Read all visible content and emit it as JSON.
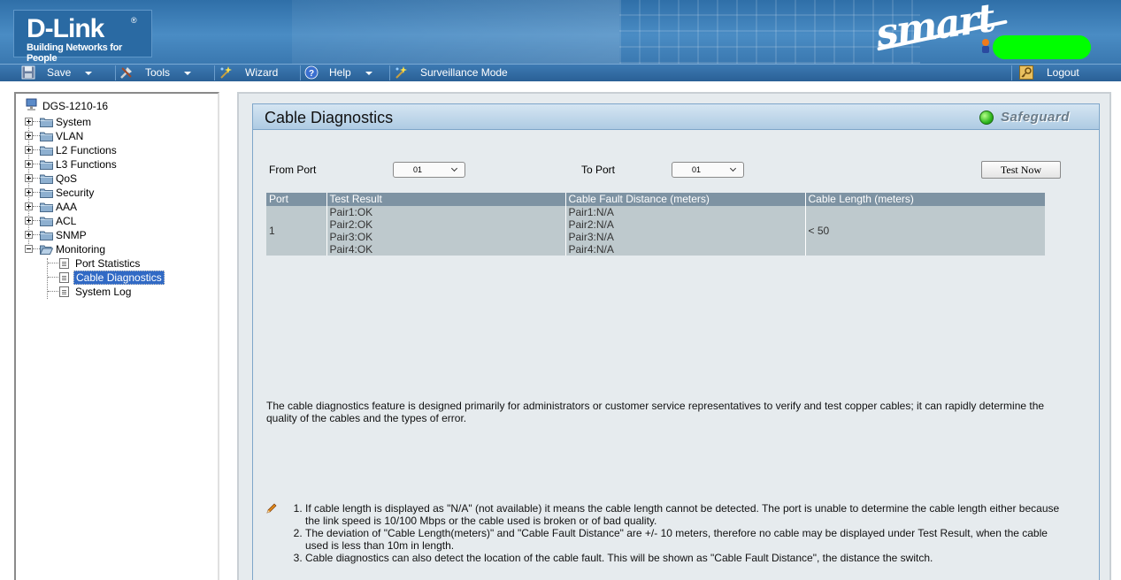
{
  "header": {
    "brand": "D-Link",
    "brand_mark": "®",
    "tagline": "Building Networks for People",
    "product_logo": "smart"
  },
  "menubar": {
    "save": "Save",
    "tools": "Tools",
    "wizard": "Wizard",
    "help": "Help",
    "surveillance": "Surveillance Mode",
    "logout": "Logout"
  },
  "tree": {
    "root": "DGS-1210-16",
    "nodes": [
      "System",
      "VLAN",
      "L2 Functions",
      "L3 Functions",
      "QoS",
      "Security",
      "AAA",
      "ACL",
      "SNMP",
      "Monitoring"
    ],
    "leaves": [
      "Port Statistics",
      "Cable Diagnostics",
      "System Log"
    ],
    "selected": "Cable Diagnostics"
  },
  "page": {
    "title": "Cable Diagnostics",
    "safeguard": "Safeguard",
    "from_port_label": "From Port",
    "from_port_value": "01",
    "to_port_label": "To Port",
    "to_port_value": "01",
    "test_button": "Test Now"
  },
  "table": {
    "headers": [
      "Port",
      "Test Result",
      "Cable Fault Distance (meters)",
      "Cable Length (meters)"
    ],
    "rows": [
      {
        "port": "1",
        "test_result": [
          "Pair1:OK",
          "Pair2:OK",
          "Pair3:OK",
          "Pair4:OK"
        ],
        "fault_distance": [
          "Pair1:N/A",
          "Pair2:N/A",
          "Pair3:N/A",
          "Pair4:N/A"
        ],
        "cable_length": "< 50"
      }
    ]
  },
  "description": "The cable diagnostics feature is designed primarily for administrators or customer service representatives to verify and test copper cables; it can rapidly determine the quality of the cables and the types of error.",
  "notes": [
    "If cable length is displayed as \"N/A\" (not available) it means the cable length cannot be detected. The port is unable to determine the cable length either because the link speed is 10/100 Mbps or the cable used is broken or of bad quality.",
    "The deviation of \"Cable Length(meters)\" and \"Cable Fault Distance\" are +/- 10 meters, therefore no cable may be displayed under Test Result, when the cable used is less than 10m in length.",
    "Cable diagnostics can also detect the location of the cable fault. This will be shown as \"Cable Fault Distance\", the distance the switch."
  ]
}
